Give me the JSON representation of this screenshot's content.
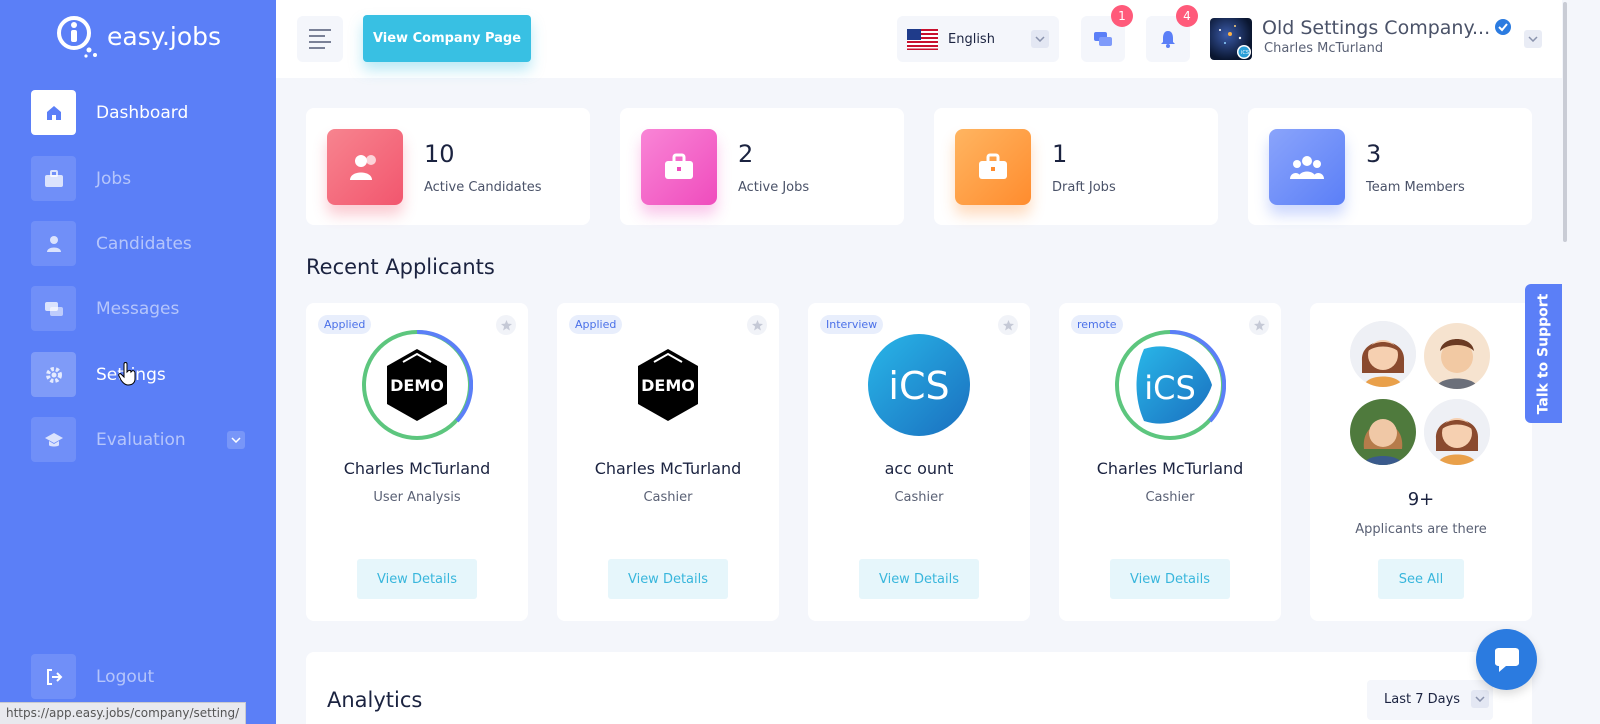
{
  "brand": {
    "name": "easy.jobs"
  },
  "sidebar": {
    "items": [
      {
        "label": "Dashboard",
        "icon": "home-icon"
      },
      {
        "label": "Jobs",
        "icon": "briefcase-icon"
      },
      {
        "label": "Candidates",
        "icon": "user-icon"
      },
      {
        "label": "Messages",
        "icon": "chat-icon"
      },
      {
        "label": "Settings",
        "icon": "gear-icon"
      },
      {
        "label": "Evaluation",
        "icon": "graduation-cap-icon"
      }
    ],
    "logout": "Logout"
  },
  "status_bar": {
    "url": "https://app.easy.jobs/company/setting/"
  },
  "topbar": {
    "view_company": "View Company Page",
    "language": "English",
    "messages_badge": "1",
    "notifications_badge": "4",
    "company_name": "Old Settings Company...",
    "user_name": "Charles McTurland"
  },
  "stats": [
    {
      "value": "10",
      "label": "Active Candidates",
      "color": "#f46a7d"
    },
    {
      "value": "2",
      "label": "Active Jobs",
      "color": "#f467c9"
    },
    {
      "value": "1",
      "label": "Draft Jobs",
      "color": "#ff9f45"
    },
    {
      "value": "3",
      "label": "Team Members",
      "color": "#6b8cf7"
    }
  ],
  "recent_applicants": {
    "title": "Recent Applicants",
    "cards": [
      {
        "tag": "Applied",
        "name": "Charles McTurland",
        "role": "User Analysis",
        "logo": "DEMO",
        "action": "View Details"
      },
      {
        "tag": "Applied",
        "name": "Charles McTurland",
        "role": "Cashier",
        "logo": "DEMO",
        "action": "View Details"
      },
      {
        "tag": "Interview",
        "name": "acc ount",
        "role": "Cashier",
        "logo": "iCS",
        "action": "View Details"
      },
      {
        "tag": "remote",
        "name": "Charles McTurland",
        "role": "Cashier",
        "logo": "iCS",
        "action": "View Details"
      }
    ],
    "more_count": "9+",
    "more_text": "Applicants are there",
    "see_all": "See All"
  },
  "analytics": {
    "title": "Analytics",
    "range": "Last 7 Days"
  },
  "support": {
    "label": "Talk to Support"
  }
}
